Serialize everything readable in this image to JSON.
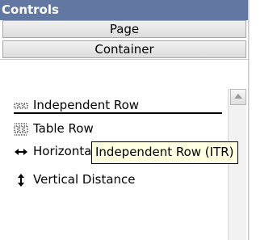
{
  "panel": {
    "title": "Controls",
    "tabs": [
      {
        "label": "Page"
      },
      {
        "label": "Container"
      }
    ],
    "items": [
      {
        "label": "Independent Row",
        "icon": "independent-row-icon"
      },
      {
        "label": "Table Row",
        "icon": "table-row-icon"
      },
      {
        "label": "Horizontal Distance",
        "icon": "horizontal-distance-icon"
      },
      {
        "label": "Vertical Distance",
        "icon": "vertical-distance-icon"
      }
    ],
    "tooltip": "Independent Row (ITR)"
  },
  "colors": {
    "header": "#6278a2",
    "header_text": "#ffffff",
    "tooltip_bg": "#ffffe1"
  }
}
